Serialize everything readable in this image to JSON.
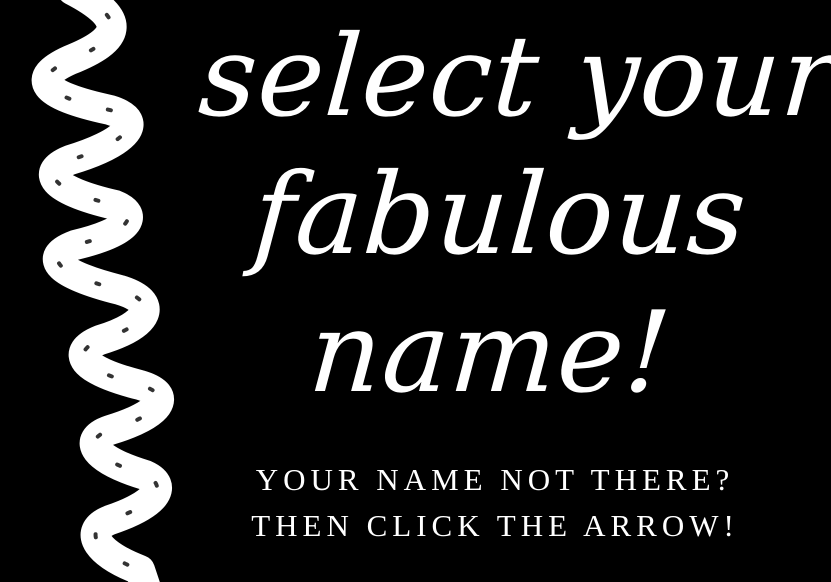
{
  "colors": {
    "background": "#000000",
    "foreground": "#ffffff"
  },
  "decoration": {
    "icon": "brush-stroke-squiggle-icon"
  },
  "headline": {
    "line1": "select your",
    "line2": "fabulous",
    "line3": "name!"
  },
  "instructions": {
    "line1": "YOUR NAME NOT THERE?",
    "line2": "THEN CLICK THE ARROW!"
  }
}
